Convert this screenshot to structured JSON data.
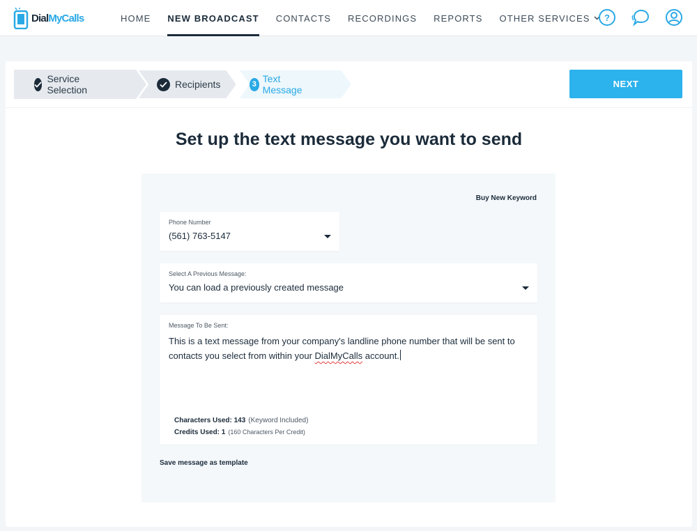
{
  "brand": {
    "name_part1": "Dial",
    "name_part2": "MyCalls",
    "accent": "#2aa9e5",
    "dark": "#1b2b3a"
  },
  "nav": {
    "items": [
      {
        "label": "HOME"
      },
      {
        "label": "NEW BROADCAST"
      },
      {
        "label": "CONTACTS"
      },
      {
        "label": "RECORDINGS"
      },
      {
        "label": "REPORTS"
      },
      {
        "label": "OTHER SERVICES"
      }
    ],
    "icons": [
      "help-icon",
      "chat-icon",
      "user-account-icon"
    ]
  },
  "steps": [
    {
      "label": "Service Selection",
      "status": "complete"
    },
    {
      "label": "Recipients",
      "status": "complete"
    },
    {
      "number": "3",
      "label": "Text Message",
      "status": "current"
    }
  ],
  "next_button": "NEXT",
  "headline": "Set up the text message you want to send",
  "buy_keyword_link": "Buy New Keyword",
  "phone_number": {
    "label": "Phone Number",
    "value": "(561) 763-5147"
  },
  "previous_message": {
    "label": "Select A Previous Message:",
    "value": "You can load a previously created message"
  },
  "message": {
    "label": "Message To Be Sent:",
    "text_before": "This is a text message from your company's landline phone number that will be sent to contacts you select from within your ",
    "text_misspelled": "DialMyCalls",
    "text_after": " account.",
    "characters_used_label": "Characters Used: 143",
    "characters_note": "(Keyword Included)",
    "credits_used_label": "Credits Used: 1",
    "credits_note": "(160 Characters Per Credit)"
  },
  "save_template_link": "Save message as template"
}
